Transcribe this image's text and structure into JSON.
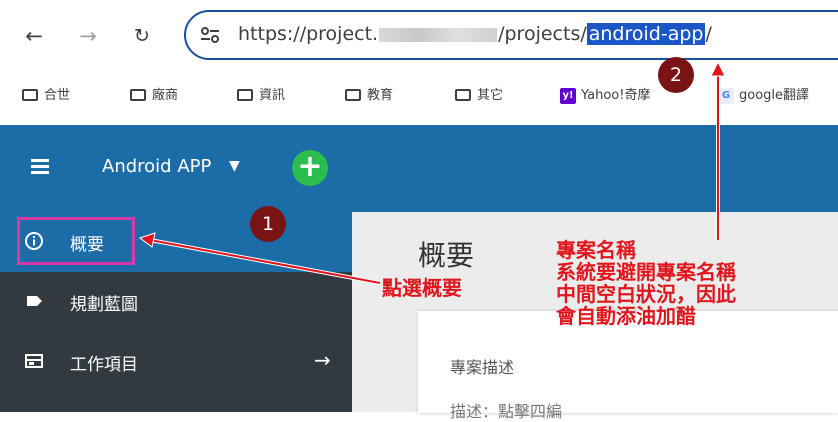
{
  "browser": {
    "url_prefix": "https://project.",
    "url_mid": "/projects/",
    "url_selected": "android-app",
    "url_suffix": "/",
    "bookmarks": [
      {
        "label": "合世",
        "icon": "folder-icon"
      },
      {
        "label": "廠商",
        "icon": "folder-icon"
      },
      {
        "label": "資訊",
        "icon": "folder-icon"
      },
      {
        "label": "教育",
        "icon": "folder-icon"
      },
      {
        "label": "其它",
        "icon": "folder-icon"
      },
      {
        "label": "Yahoo!奇摩",
        "icon": "yahoo-icon"
      },
      {
        "label": "google翻譯",
        "icon": "google-translate-icon"
      }
    ]
  },
  "header": {
    "project_name": "Android APP",
    "caret": "▼",
    "add_symbol": "+"
  },
  "sidebar": {
    "items": [
      {
        "label": "概要",
        "icon": "info-icon",
        "active": true
      },
      {
        "label": "規劃藍圖",
        "icon": "tag-icon"
      },
      {
        "label": "工作項目",
        "icon": "board-icon",
        "arrow": "→"
      }
    ]
  },
  "main": {
    "title": "概要",
    "card_title": "專案描述",
    "card_next": "描述：點擊四編"
  },
  "annotations": {
    "marker_1": "1",
    "marker_2": "2",
    "note_1": "點選概要",
    "note_2_lines": [
      "專案名稱",
      "系統要避開專案名稱",
      "中間空白狀況，因此",
      "會自動添油加醋"
    ]
  },
  "colors": {
    "accent": "#1c6ca8",
    "sidebar": "#323a40",
    "annotation_red": "#e0161e",
    "marker": "#7a1414",
    "highlight_box": "#d63aa6",
    "add_button": "#2bbd4e"
  }
}
